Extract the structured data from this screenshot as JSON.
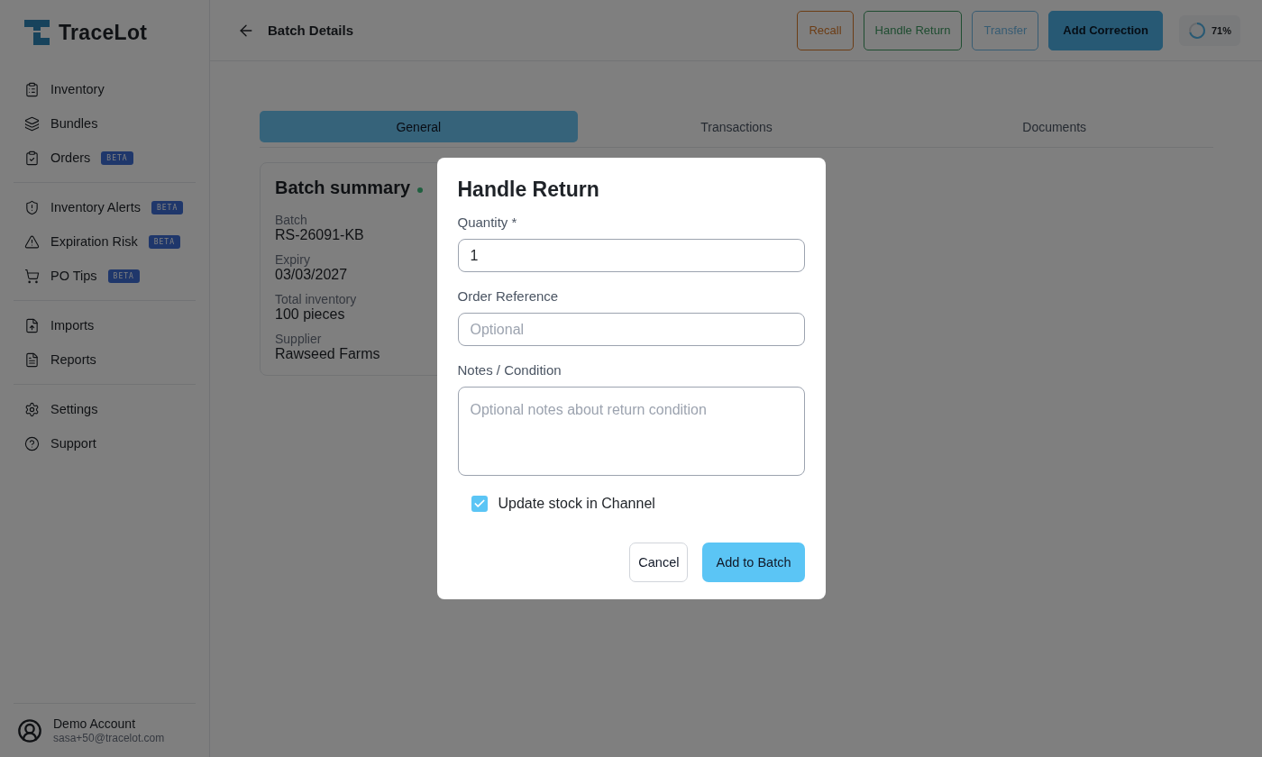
{
  "brand": {
    "name": "TraceLot"
  },
  "sidebar": {
    "groups": [
      {
        "items": [
          {
            "label": "Inventory"
          },
          {
            "label": "Bundles"
          },
          {
            "label": "Orders",
            "badge": "BETA"
          }
        ]
      },
      {
        "items": [
          {
            "label": "Inventory Alerts",
            "badge": "BETA"
          },
          {
            "label": "Expiration Risk",
            "badge": "BETA"
          },
          {
            "label": "PO Tips",
            "badge": "BETA"
          }
        ]
      },
      {
        "items": [
          {
            "label": "Imports"
          },
          {
            "label": "Reports"
          }
        ]
      },
      {
        "items": [
          {
            "label": "Settings"
          },
          {
            "label": "Support"
          }
        ]
      }
    ],
    "account": {
      "name": "Demo Account",
      "email": "sasa+50@tracelot.com"
    }
  },
  "header": {
    "title": "Batch Details",
    "actions": [
      {
        "label": "Recall",
        "kind": "warning"
      },
      {
        "label": "Handle Return",
        "kind": "success"
      },
      {
        "label": "Transfer",
        "kind": "info"
      },
      {
        "label": "Add Correction",
        "kind": "primary"
      }
    ],
    "progress": {
      "level": 0.71,
      "reading": "71%"
    }
  },
  "tabs": [
    {
      "label": "General",
      "selected": true
    },
    {
      "label": "Transactions",
      "selected": false
    },
    {
      "label": "Documents",
      "selected": false
    }
  ],
  "summary": {
    "title": "Batch summary",
    "fields": [
      {
        "label": "Batch",
        "value": "RS-26091-KB"
      },
      {
        "label": "Expiry",
        "value": "03/03/2027"
      },
      {
        "label": "Total inventory",
        "value": "100 pieces"
      },
      {
        "label": "Supplier",
        "value": "Rawseed Farms"
      }
    ]
  },
  "dialog": {
    "title": "Handle Return",
    "fields": [
      {
        "label": "Quantity *",
        "kind": "input",
        "value": "1"
      },
      {
        "label": "Order Reference",
        "kind": "input",
        "placeholder": "Optional"
      },
      {
        "label": "Notes / Condition",
        "kind": "textarea",
        "placeholder": "Optional notes about return condition"
      }
    ],
    "checkbox": {
      "label": "Update stock in Channel",
      "checked": true
    },
    "buttons": [
      {
        "label": "Cancel",
        "kind": "secondary"
      },
      {
        "label": "Add to Batch",
        "kind": "primary"
      }
    ]
  }
}
